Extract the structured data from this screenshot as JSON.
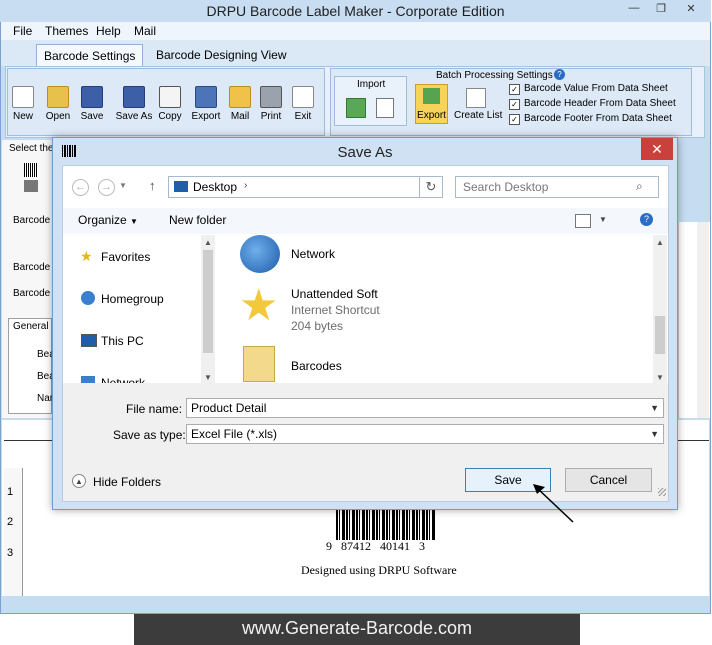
{
  "app": {
    "title": "DRPU Barcode Label Maker - Corporate Edition"
  },
  "menu": [
    "File",
    "Themes",
    "Help",
    "Mail"
  ],
  "tabs": [
    "Barcode Settings",
    "Barcode Designing View"
  ],
  "toolbar": {
    "buttons": [
      "New",
      "Open",
      "Save",
      "Save As",
      "Copy",
      "Export",
      "Mail",
      "Print",
      "Exit"
    ]
  },
  "import_group": {
    "title": "Import",
    "batch_title": "Batch Processing Settings",
    "export_label": "Export",
    "create_list_label": "Create List",
    "checkboxes": [
      "Barcode Value From Data Sheet",
      "Barcode Header From Data Sheet",
      "Barcode Footer From Data Sheet"
    ]
  },
  "background": {
    "select_label": "Select the",
    "barcode_v": "Barcode V",
    "barcode_h": "Barcode H",
    "barcode_f": "Barcode F",
    "general_tab": "General S",
    "row1": "Bea",
    "row2": "Bea",
    "row3": "Nar",
    "ruler": [
      "1",
      "2",
      "3"
    ],
    "barcode_number": "9   87412   40141   3",
    "designed_text": "Designed using DRPU Software"
  },
  "dialog": {
    "title": "Save As",
    "close_label": "✕",
    "address": "Desktop",
    "search_placeholder": "Search Desktop",
    "organize": "Organize",
    "new_folder": "New folder",
    "tree": [
      "Favorites",
      "Homegroup",
      "This PC",
      "Network"
    ],
    "files": [
      {
        "name": "Network",
        "type": "",
        "size": ""
      },
      {
        "name": "Unattended Soft",
        "type": "Internet Shortcut",
        "size": "204 bytes"
      },
      {
        "name": "Barcodes",
        "type": "",
        "size": ""
      }
    ],
    "file_name_label": "File name:",
    "file_name_value": "Product Detail",
    "save_type_label": "Save as type:",
    "save_type_value": "Excel File (*.xls)",
    "hide_folders": "Hide Folders",
    "save_button": "Save",
    "cancel_button": "Cancel"
  },
  "footer": {
    "url": "www.Generate-Barcode.com"
  }
}
